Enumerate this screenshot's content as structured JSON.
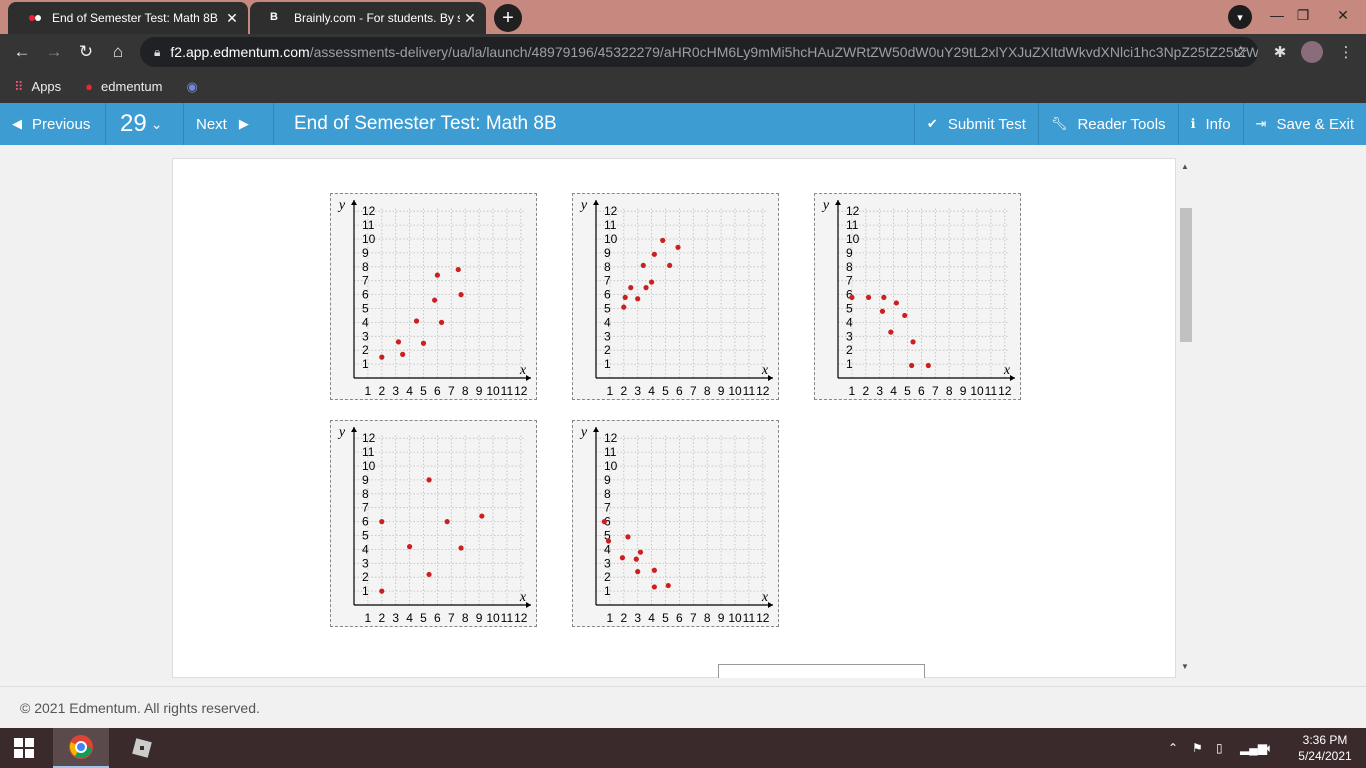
{
  "browser": {
    "tabs": [
      {
        "title": "End of Semester Test: Math 8B",
        "active": true
      },
      {
        "title": "Brainly.com - For students. By stu",
        "active": false
      }
    ],
    "url_host": "f2.app.edmentum.com",
    "url_path": "/assessments-delivery/ua/la/launch/48979196/45322279/aHR0cHM6Ly9mMi5hcHAuZWRtZW50dW0uY29tL2xlYXJuZXItdWkvdXNlci1hc3NpZ25tZ25tZW50dGZ...",
    "bookmarks": [
      {
        "label": "Apps",
        "icon": "apps-grid-icon"
      },
      {
        "label": "edmentum",
        "icon": "edmentum-icon"
      },
      {
        "label": "",
        "icon": "discord-icon"
      }
    ]
  },
  "header": {
    "previous_label": "Previous",
    "question_number": "29",
    "next_label": "Next",
    "title": "End of Semester Test: Math 8B",
    "submit_label": "Submit Test",
    "reader_tools_label": "Reader Tools",
    "info_label": "Info",
    "save_exit_label": "Save & Exit"
  },
  "footer": {
    "copyright": "© 2021 Edmentum. All rights reserved."
  },
  "taskbar": {
    "time": "3:36 PM",
    "date": "5/24/2021"
  },
  "colors": {
    "accent": "#3d9cd2",
    "point": "#cc1f1f"
  },
  "chart_data": [
    {
      "type": "scatter",
      "xlabel": "x",
      "ylabel": "y",
      "xlim": [
        0,
        12
      ],
      "ylim": [
        0,
        12
      ],
      "x_ticks": [
        1,
        2,
        3,
        4,
        5,
        6,
        7,
        8,
        9,
        10,
        11,
        12
      ],
      "y_ticks": [
        1,
        2,
        3,
        4,
        5,
        6,
        7,
        8,
        9,
        10,
        11,
        12
      ],
      "points": [
        [
          2,
          1.5
        ],
        [
          3.2,
          2.6
        ],
        [
          3.5,
          1.7
        ],
        [
          4.5,
          4.1
        ],
        [
          5,
          2.5
        ],
        [
          5.8,
          5.6
        ],
        [
          6,
          7.4
        ],
        [
          6.3,
          4
        ],
        [
          7.5,
          7.8
        ],
        [
          7.7,
          6
        ]
      ]
    },
    {
      "type": "scatter",
      "xlabel": "x",
      "ylabel": "y",
      "xlim": [
        0,
        12
      ],
      "ylim": [
        0,
        12
      ],
      "x_ticks": [
        1,
        2,
        3,
        4,
        5,
        6,
        7,
        8,
        9,
        10,
        11,
        12
      ],
      "y_ticks": [
        1,
        2,
        3,
        4,
        5,
        6,
        7,
        8,
        9,
        10,
        11,
        12
      ],
      "points": [
        [
          2,
          5.1
        ],
        [
          2.1,
          5.8
        ],
        [
          2.5,
          6.5
        ],
        [
          3,
          5.7
        ],
        [
          3.4,
          8.1
        ],
        [
          3.6,
          6.5
        ],
        [
          4,
          6.9
        ],
        [
          4.2,
          8.9
        ],
        [
          4.8,
          9.9
        ],
        [
          5.3,
          8.1
        ],
        [
          5.9,
          9.4
        ]
      ]
    },
    {
      "type": "scatter",
      "xlabel": "x",
      "ylabel": "y",
      "xlim": [
        0,
        12
      ],
      "ylim": [
        0,
        12
      ],
      "x_ticks": [
        1,
        2,
        3,
        4,
        5,
        6,
        7,
        8,
        9,
        10,
        11,
        12
      ],
      "y_ticks": [
        1,
        2,
        3,
        4,
        5,
        6,
        7,
        8,
        9,
        10,
        11,
        12
      ],
      "points": [
        [
          1,
          5.8
        ],
        [
          2.2,
          5.8
        ],
        [
          3.3,
          5.8
        ],
        [
          3.2,
          4.8
        ],
        [
          3.8,
          3.3
        ],
        [
          4.2,
          5.4
        ],
        [
          4.8,
          4.5
        ],
        [
          5.4,
          2.6
        ],
        [
          5.3,
          0.9
        ],
        [
          6.5,
          0.9
        ]
      ]
    },
    {
      "type": "scatter",
      "xlabel": "x",
      "ylabel": "y",
      "xlim": [
        0,
        12
      ],
      "ylim": [
        0,
        12
      ],
      "x_ticks": [
        1,
        2,
        3,
        4,
        5,
        6,
        7,
        8,
        9,
        10,
        11,
        12
      ],
      "y_ticks": [
        1,
        2,
        3,
        4,
        5,
        6,
        7,
        8,
        9,
        10,
        11,
        12
      ],
      "points": [
        [
          2,
          6
        ],
        [
          2,
          1
        ],
        [
          4,
          4.2
        ],
        [
          5.4,
          9
        ],
        [
          5.4,
          2.2
        ],
        [
          6.7,
          6
        ],
        [
          7.7,
          4.1
        ],
        [
          9.2,
          6.4
        ]
      ]
    },
    {
      "type": "scatter",
      "xlabel": "x",
      "ylabel": "y",
      "xlim": [
        0,
        12
      ],
      "ylim": [
        0,
        12
      ],
      "x_ticks": [
        1,
        2,
        3,
        4,
        5,
        6,
        7,
        8,
        9,
        10,
        11,
        12
      ],
      "y_ticks": [
        1,
        2,
        3,
        4,
        5,
        6,
        7,
        8,
        9,
        10,
        11,
        12
      ],
      "points": [
        [
          0.6,
          6
        ],
        [
          0.9,
          4.6
        ],
        [
          1.9,
          3.4
        ],
        [
          2.3,
          4.9
        ],
        [
          2.9,
          3.3
        ],
        [
          3.2,
          3.8
        ],
        [
          3,
          2.4
        ],
        [
          4.2,
          2.5
        ],
        [
          4.2,
          1.3
        ],
        [
          5.2,
          1.4
        ]
      ]
    }
  ]
}
